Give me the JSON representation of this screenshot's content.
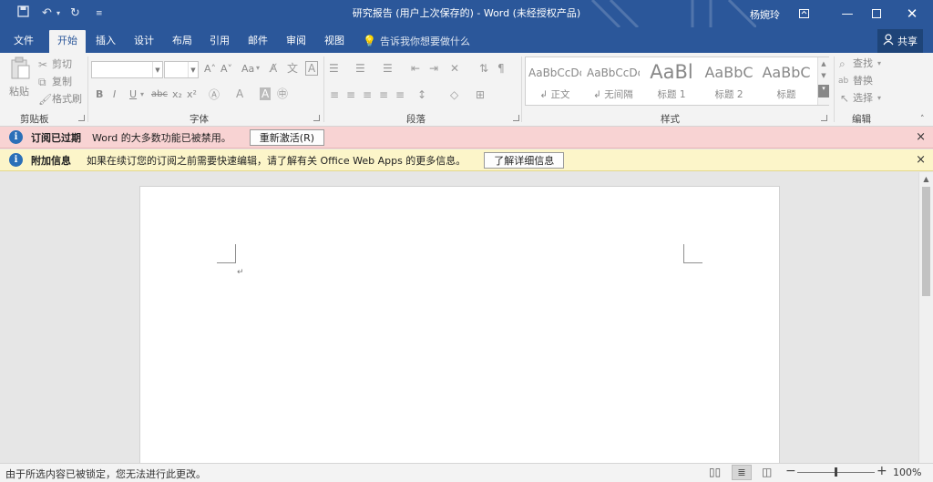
{
  "titlebar": {
    "title": "研究报告 (用户上次保存的)  -  Word (未经授权产品)",
    "user": "杨婉玲",
    "icons": [
      "save-icon",
      "undo-icon",
      "redo-icon",
      "customize-icon"
    ],
    "bg_color": "#2b579a"
  },
  "tabs": [
    {
      "label": "文件"
    },
    {
      "label": "开始"
    },
    {
      "label": "插入"
    },
    {
      "label": "设计"
    },
    {
      "label": "布局"
    },
    {
      "label": "引用"
    },
    {
      "label": "邮件"
    },
    {
      "label": "审阅"
    },
    {
      "label": "视图"
    }
  ],
  "tell_me": "告诉我你想要做什么",
  "share": "共享",
  "ribbon": {
    "clipboard": {
      "paste": "粘贴",
      "cut": "剪切",
      "copy": "复制",
      "painter": "格式刷",
      "label": "剪贴板"
    },
    "font": {
      "label": "字体",
      "bold": "B",
      "italic": "I",
      "underline": "U",
      "strike": "abc",
      "sub": "x₂",
      "sup": "x²",
      "grow": "A˄",
      "shrink": "A˅",
      "case": "Aa"
    },
    "paragraph": {
      "label": "段落"
    },
    "styles": {
      "label": "样式",
      "items": [
        {
          "sample": "AaBbCcDc",
          "name": "↲ 正文"
        },
        {
          "sample": "AaBbCcDc",
          "name": "↲ 无间隔"
        },
        {
          "sample": "AaBl",
          "name": "标题 1"
        },
        {
          "sample": "AaBbC",
          "name": "标题 2"
        },
        {
          "sample": "AaBbC",
          "name": "标题"
        }
      ]
    },
    "editing": {
      "find": "查找",
      "replace": "替换",
      "select": "选择",
      "label": "编辑"
    }
  },
  "messages": [
    {
      "title": "订阅已过期",
      "text": "Word 的大多数功能已被禁用。",
      "button": "重新激活(R)"
    },
    {
      "title": "附加信息",
      "text": "如果在续订您的订阅之前需要快速编辑，请了解有关 Office Web Apps 的更多信息。",
      "button": "了解详细信息"
    }
  ],
  "document": {
    "paragraph_mark": "↵"
  },
  "status": {
    "text": "由于所选内容已被锁定，您无法进行此更改。",
    "zoom": "100%",
    "zoom_level_percent": 100
  }
}
